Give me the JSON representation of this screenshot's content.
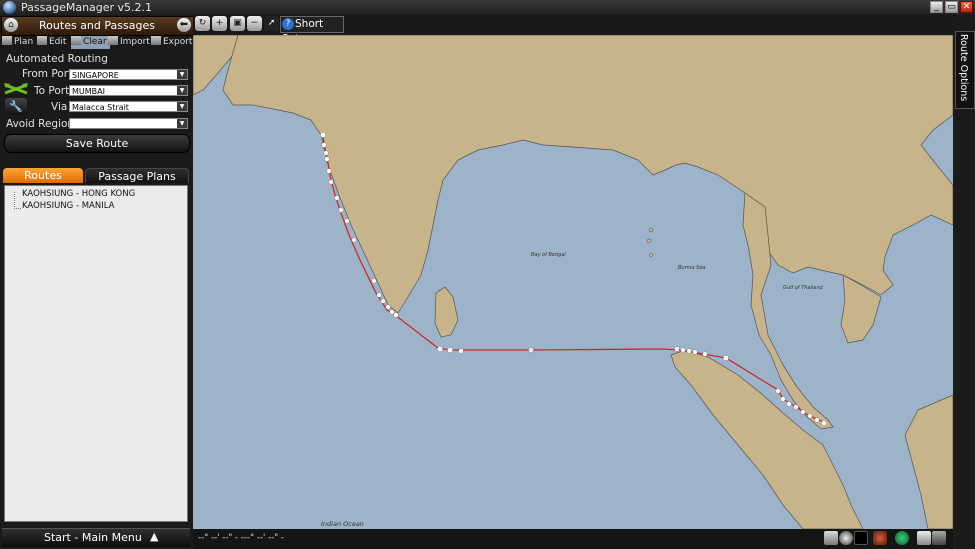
{
  "window": {
    "title": "PassageManager v5.2.1",
    "buttons": [
      "_",
      "▭",
      "✕"
    ]
  },
  "panel": {
    "title": "Routes and Passages",
    "toolbar": {
      "plan": "Plan",
      "edit": "Edit",
      "clear": "Clear",
      "import": "Import",
      "export": "Export"
    },
    "automated_routing": {
      "heading": "Automated Routing",
      "from_port_label": "From Port",
      "from_port_value": "SINGAPORE",
      "to_port_label": "To Port",
      "to_port_value": "MUMBAI",
      "via_label": "Via",
      "via_value": "Malacca Strait",
      "avoid_region_label": "Avoid Region",
      "avoid_region_value": ""
    },
    "save_route_label": "Save Route",
    "tabs": [
      "Routes",
      "Passage Plans"
    ],
    "active_tab": "Routes",
    "routes": [
      "KAOHSIUNG - HONG KONG",
      "KAOHSIUNG - MANILA"
    ],
    "main_menu_label": "Start - Main Menu"
  },
  "map_toolbar": {
    "shortcuts_label": "Short Cuts"
  },
  "map": {
    "labels": {
      "bay_of_bengal": "Bay of Bengal",
      "burma_sea": "Burma Sea",
      "gulf_of_thailand": "Gulf of Thailand",
      "indian_ocean": "Indian Ocean"
    },
    "colors": {
      "sea": "#9cb3c9",
      "land": "#c7b48a",
      "route": "#cc2a2a"
    }
  },
  "status": {
    "coordinates": "--° --' --\" - ---° --' --\" -"
  },
  "right_panel": {
    "tab_label": "Route Options"
  }
}
